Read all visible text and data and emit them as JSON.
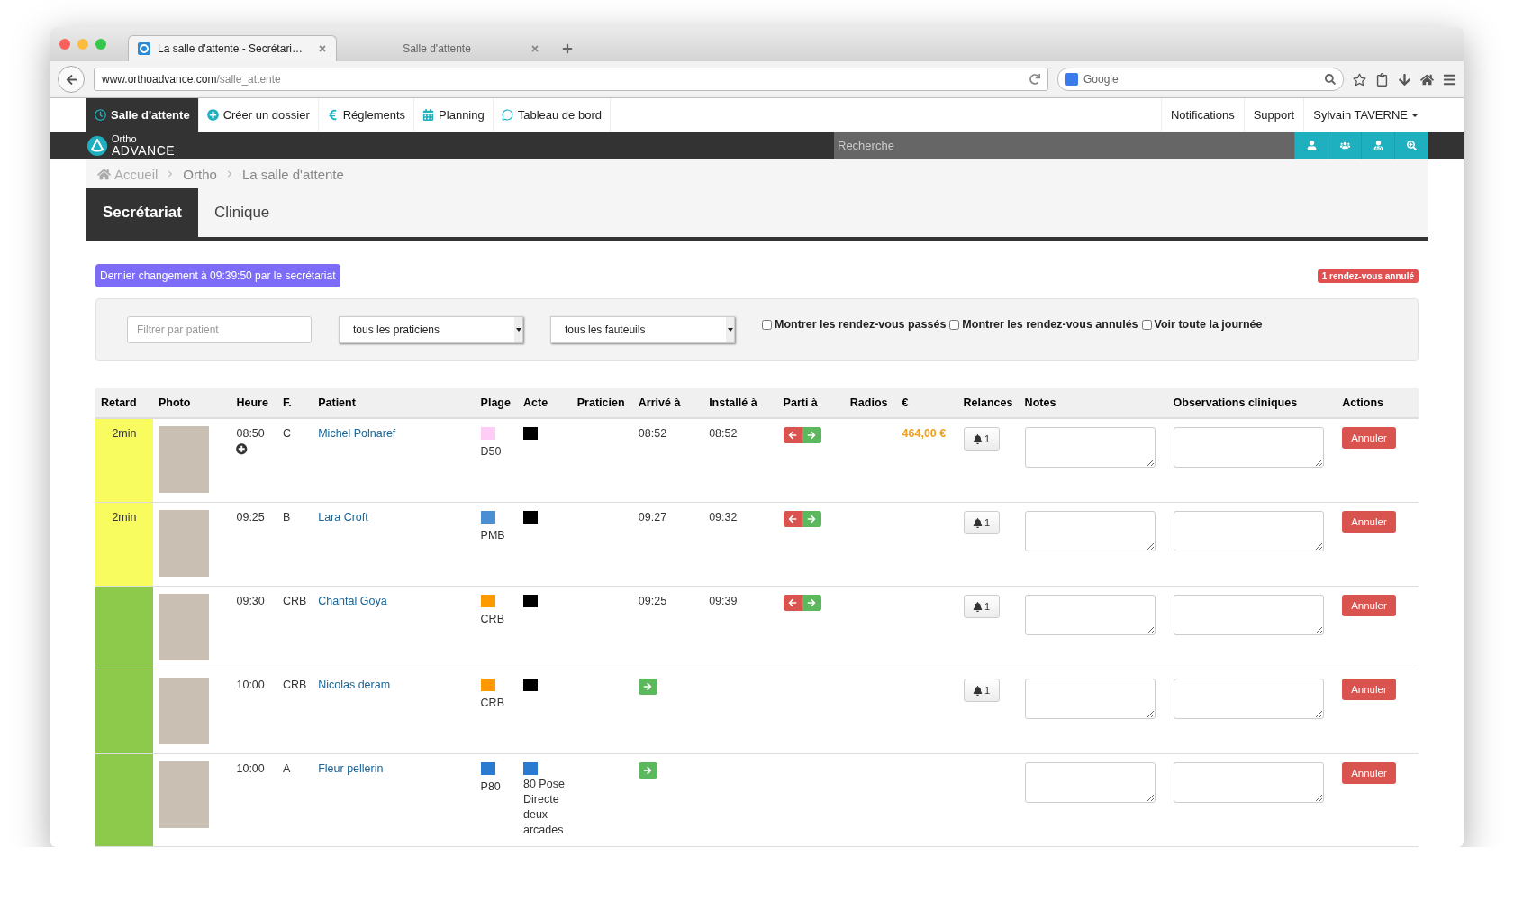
{
  "browser": {
    "tabs": [
      {
        "title": "La salle d'attente - Secrétari…",
        "selected": true
      },
      {
        "title": "Salle d'attente",
        "selected": false
      }
    ],
    "url": {
      "host": "www.orthoadvance.com",
      "path": "/salle_attente"
    },
    "search_placeholder": "Google"
  },
  "nav": {
    "items": [
      {
        "label": "Salle d'attente",
        "selected": true
      },
      {
        "label": "Créer un dossier",
        "selected": false
      },
      {
        "label": "Réglements",
        "selected": false
      },
      {
        "label": "Planning",
        "selected": false
      },
      {
        "label": "Tableau de bord",
        "selected": false
      }
    ],
    "right": [
      "Notifications",
      "Support",
      "Sylvain TAVERNE"
    ]
  },
  "logo": {
    "top": "Ortho",
    "bottom": "ADVANCE"
  },
  "search": {
    "placeholder": "Recherche"
  },
  "breadcrumb": [
    "Accueil",
    "Ortho",
    "La salle d'attente"
  ],
  "tabs": [
    {
      "label": "Secrétariat",
      "selected": true
    },
    {
      "label": "Clinique",
      "selected": false
    }
  ],
  "last_change": "Dernier changement à 09:39:50 par le secrétariat",
  "cancelled_badge": "1 rendez-vous annulé",
  "filters": {
    "patient_placeholder": "Filtrer par patient",
    "practitioner": "tous les praticiens",
    "chair": "tous les fauteuils",
    "checkboxes": [
      {
        "label": "Montrer les rendez-vous passés",
        "checked": false
      },
      {
        "label": "Montrer les rendez-vous annulés",
        "checked": false
      },
      {
        "label": "Voir toute la journée",
        "checked": false
      }
    ]
  },
  "table": {
    "columns": [
      "Retard",
      "Photo",
      "Heure",
      "F.",
      "Patient",
      "Plage",
      "Acte",
      "Praticien",
      "Arrivé à",
      "Installé à",
      "Parti à",
      "Radios",
      "€",
      "Relances",
      "Notes",
      "Observations cliniques",
      "Actions"
    ],
    "rows": [
      {
        "delay": "2min",
        "color": "#f9fc5f",
        "time": "08:50",
        "add_icon": true,
        "f": "C",
        "patient": "Michel Polnaref",
        "plage": {
          "color": "#ffccf5",
          "label": "D50"
        },
        "acte": {
          "color": "#000000"
        },
        "arrival": {
          "kind": "time",
          "text": "08:52"
        },
        "installed": "08:52",
        "departure": {
          "kind": "buttons"
        },
        "amount": "464,00 €",
        "reminder": "1",
        "action": "Annuler"
      },
      {
        "delay": "2min",
        "color": "#f9fc5f",
        "time": "09:25",
        "add_icon": false,
        "f": "B",
        "patient": "Lara Croft",
        "plage": {
          "color": "#4a8fd4",
          "label": "PMB"
        },
        "acte": {
          "color": "#000000"
        },
        "arrival": {
          "kind": "time",
          "text": "09:27"
        },
        "installed": "09:32",
        "departure": {
          "kind": "buttons"
        },
        "reminder": "1",
        "action": "Annuler"
      },
      {
        "color": "#8dc94a",
        "time": "09:30",
        "add_icon": false,
        "f": "CRB",
        "patient": "Chantal Goya",
        "plage": {
          "color": "#ff9900",
          "label": "CRB"
        },
        "acte": {
          "color": "#000000"
        },
        "arrival": {
          "kind": "time",
          "text": "09:25"
        },
        "installed": "09:39",
        "departure": {
          "kind": "buttons"
        },
        "reminder": "1",
        "action": "Annuler"
      },
      {
        "color": "#8dc94a",
        "time": "10:00",
        "add_icon": false,
        "f": "CRB",
        "patient": "Nicolas deram",
        "plage": {
          "color": "#ff9900",
          "label": "CRB"
        },
        "acte": {
          "color": "#000000"
        },
        "arrival": {
          "kind": "button"
        },
        "reminder": "1",
        "action": "Annuler"
      },
      {
        "color": "#8dc94a",
        "time": "10:00",
        "add_icon": false,
        "f": "A",
        "patient": "Fleur pellerin",
        "plage": {
          "color": "#2a7ad0",
          "label": "P80"
        },
        "acte": {
          "color": "#2a7ad0",
          "label": "80 Pose Directe deux arcades"
        },
        "arrival": {
          "kind": "button"
        },
        "action": "Annuler"
      }
    ]
  }
}
